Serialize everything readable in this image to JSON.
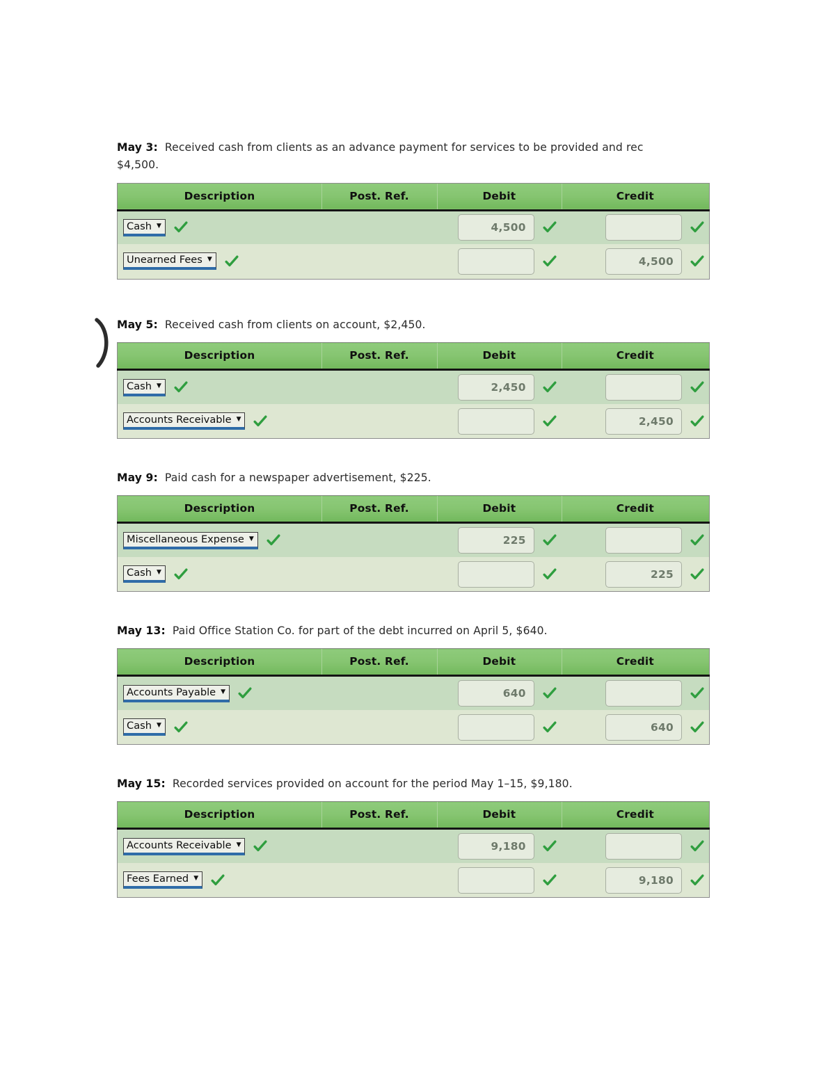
{
  "document": {
    "type": "journal-entry-worksheet",
    "colors": {
      "header_green": "#86c571",
      "row_odd": "#c6dcc0",
      "row_even": "#dee7d2",
      "check_green": "#2f9e3f",
      "select_underline_blue": "#2f6ca8",
      "input_fill": "#e6ecdf",
      "input_text": "#6e7a6b"
    },
    "columns": [
      "Description",
      "Post. Ref.",
      "Debit",
      "Credit"
    ],
    "icons": {
      "checkmark": "check-icon",
      "caret": "chevron-down-icon",
      "annotation": "paren-annotation-icon"
    }
  },
  "annotation": {
    "mark": ")"
  },
  "entries": [
    {
      "id": "may-3",
      "date_label": "May 3:",
      "description": "Received cash from clients as an advance payment for services to be provided and rec",
      "description_line2": "$4,500.",
      "rows": [
        {
          "account": "Cash",
          "debit": "4,500",
          "credit": "",
          "post_ref": ""
        },
        {
          "account": "Unearned Fees",
          "debit": "",
          "credit": "4,500",
          "post_ref": ""
        }
      ]
    },
    {
      "id": "may-5",
      "date_label": "May 5:",
      "description": "Received cash from clients on account, $2,450.",
      "rows": [
        {
          "account": "Cash",
          "debit": "2,450",
          "credit": "",
          "post_ref": ""
        },
        {
          "account": "Accounts Receivable",
          "debit": "",
          "credit": "2,450",
          "post_ref": ""
        }
      ]
    },
    {
      "id": "may-9",
      "date_label": "May 9:",
      "description": "Paid cash for a newspaper advertisement, $225.",
      "rows": [
        {
          "account": "Miscellaneous Expense",
          "debit": "225",
          "credit": "",
          "post_ref": ""
        },
        {
          "account": "Cash",
          "debit": "",
          "credit": "225",
          "post_ref": ""
        }
      ]
    },
    {
      "id": "may-13",
      "date_label": "May 13:",
      "description": "Paid Office Station Co. for part of the debt incurred on April 5, $640.",
      "rows": [
        {
          "account": "Accounts Payable",
          "debit": "640",
          "credit": "",
          "post_ref": ""
        },
        {
          "account": "Cash",
          "debit": "",
          "credit": "640",
          "post_ref": ""
        }
      ]
    },
    {
      "id": "may-15",
      "date_label": "May 15:",
      "description": "Recorded services provided on account for the period May 1–15, $9,180.",
      "rows": [
        {
          "account": "Accounts Receivable",
          "debit": "9,180",
          "credit": "",
          "post_ref": ""
        },
        {
          "account": "Fees Earned",
          "debit": "",
          "credit": "9,180",
          "post_ref": ""
        }
      ]
    }
  ]
}
